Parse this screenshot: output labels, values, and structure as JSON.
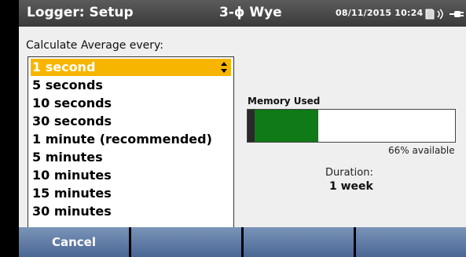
{
  "header": {
    "title": "Logger: Setup",
    "mode": "3-ϕ Wye",
    "datetime": "08/11/2015 10:24",
    "icons": [
      "sd-card-icon",
      "wireless-icon",
      "battery-plug-icon"
    ]
  },
  "setup": {
    "calc_label": "Calculate Average every:",
    "options": [
      "1 second",
      "5 seconds",
      "10 seconds",
      "30 seconds",
      "1 minute (recommended)",
      "5 minutes",
      "10 minutes",
      "15 minutes",
      "30 minutes"
    ],
    "selected": "1 second"
  },
  "memory": {
    "label": "Memory Used",
    "used_fraction": 0.34,
    "available_text": "66% available"
  },
  "duration": {
    "label": "Duration:",
    "value": "1 week"
  },
  "softkeys": {
    "cancel": "Cancel",
    "f2": "",
    "f3": "",
    "f4": ""
  },
  "colors": {
    "selection": "#f7b500",
    "memory_bar": "#0f7a16",
    "softkey": "#5f7ba6"
  }
}
